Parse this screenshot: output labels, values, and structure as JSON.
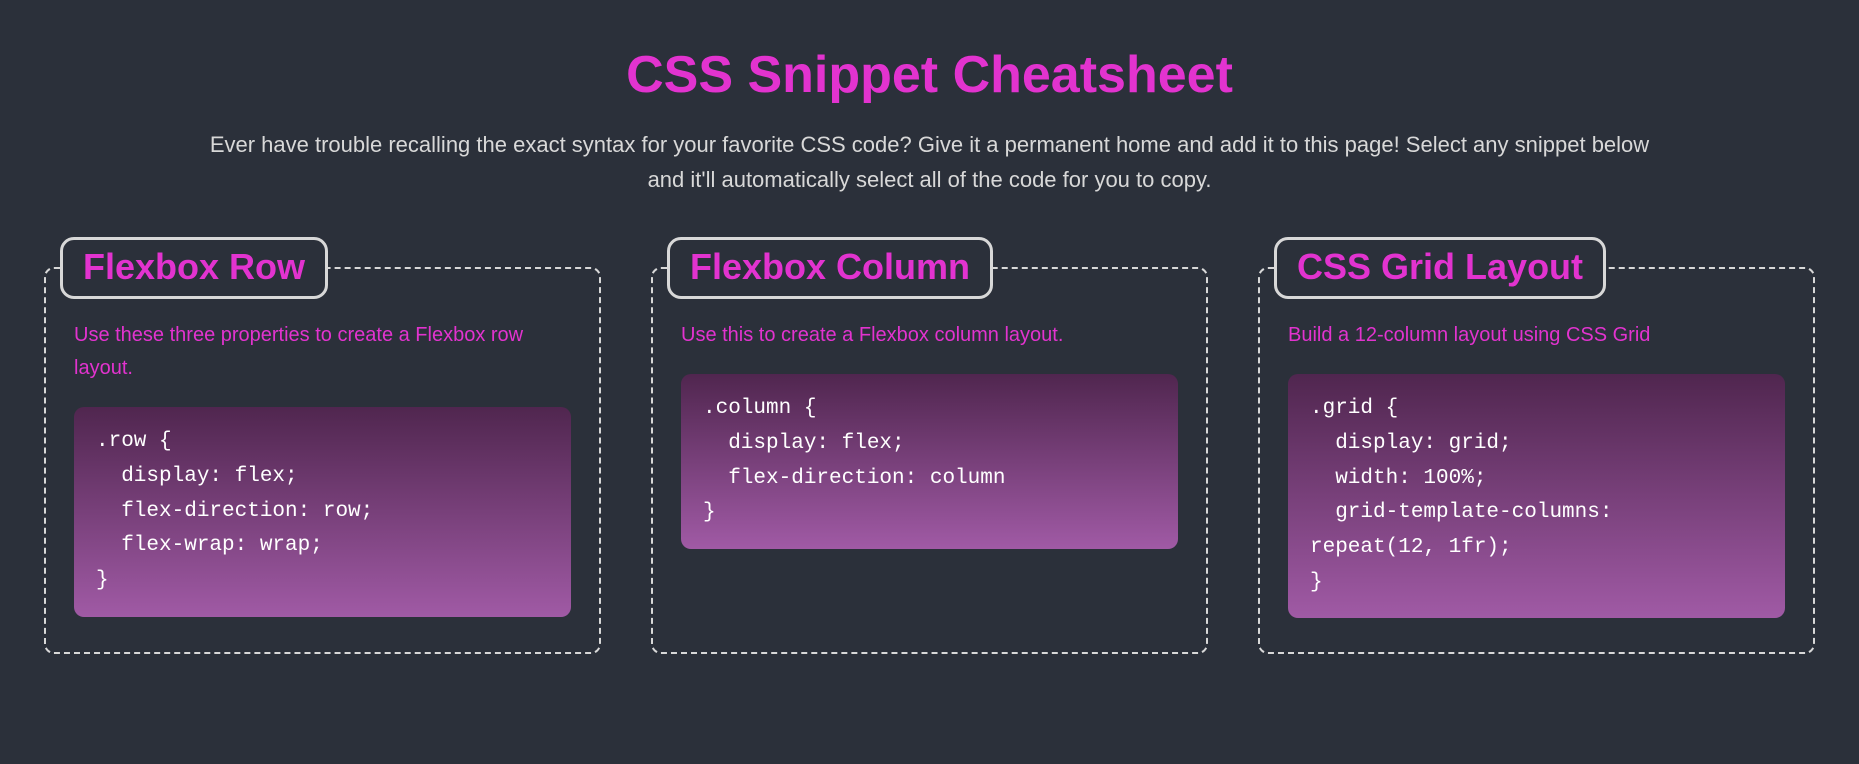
{
  "header": {
    "title": "CSS Snippet Cheatsheet",
    "subtitle": "Ever have trouble recalling the exact syntax for your favorite CSS code? Give it a permanent home and add it to this page! Select any snippet below and it'll automatically select all of the code for you to copy."
  },
  "cards": [
    {
      "title": "Flexbox Row",
      "desc": "Use these three properties to create a Flexbox row layout.",
      "code": ".row {\n  display: flex;\n  flex-direction: row;\n  flex-wrap: wrap;\n}"
    },
    {
      "title": "Flexbox Column",
      "desc": "Use this to create a Flexbox column layout.",
      "code": ".column {\n  display: flex;\n  flex-direction: column\n}"
    },
    {
      "title": "CSS Grid Layout",
      "desc": "Build a 12-column layout using CSS Grid",
      "code": ".grid {\n  display: grid;\n  width: 100%;\n  grid-template-columns: \nrepeat(12, 1fr);\n}"
    }
  ]
}
